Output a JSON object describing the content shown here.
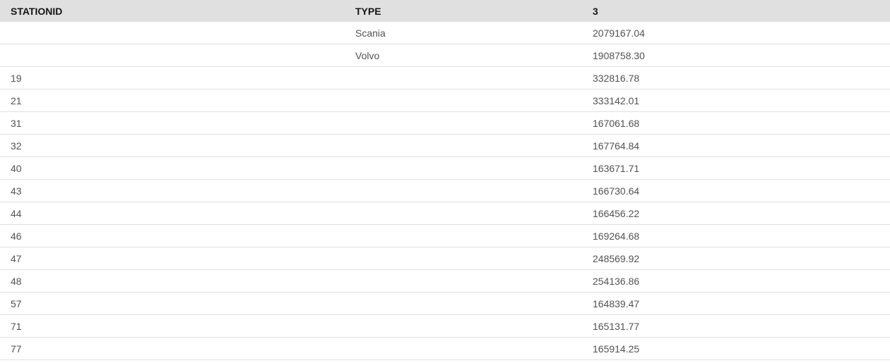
{
  "table": {
    "columns": [
      "STATIONID",
      "TYPE",
      "3"
    ],
    "rows": [
      {
        "stationid": "",
        "type": "Scania",
        "value": "2079167.04"
      },
      {
        "stationid": "",
        "type": "Volvo",
        "value": "1908758.30"
      },
      {
        "stationid": "19",
        "type": "",
        "value": "332816.78"
      },
      {
        "stationid": "21",
        "type": "",
        "value": "333142.01"
      },
      {
        "stationid": "31",
        "type": "",
        "value": "167061.68"
      },
      {
        "stationid": "32",
        "type": "",
        "value": "167764.84"
      },
      {
        "stationid": "40",
        "type": "",
        "value": "163671.71"
      },
      {
        "stationid": "43",
        "type": "",
        "value": "166730.64"
      },
      {
        "stationid": "44",
        "type": "",
        "value": "166456.22"
      },
      {
        "stationid": "46",
        "type": "",
        "value": "169264.68"
      },
      {
        "stationid": "47",
        "type": "",
        "value": "248569.92"
      },
      {
        "stationid": "48",
        "type": "",
        "value": "254136.86"
      },
      {
        "stationid": "57",
        "type": "",
        "value": "164839.47"
      },
      {
        "stationid": "71",
        "type": "",
        "value": "165131.77"
      },
      {
        "stationid": "77",
        "type": "",
        "value": "165914.25"
      }
    ]
  }
}
